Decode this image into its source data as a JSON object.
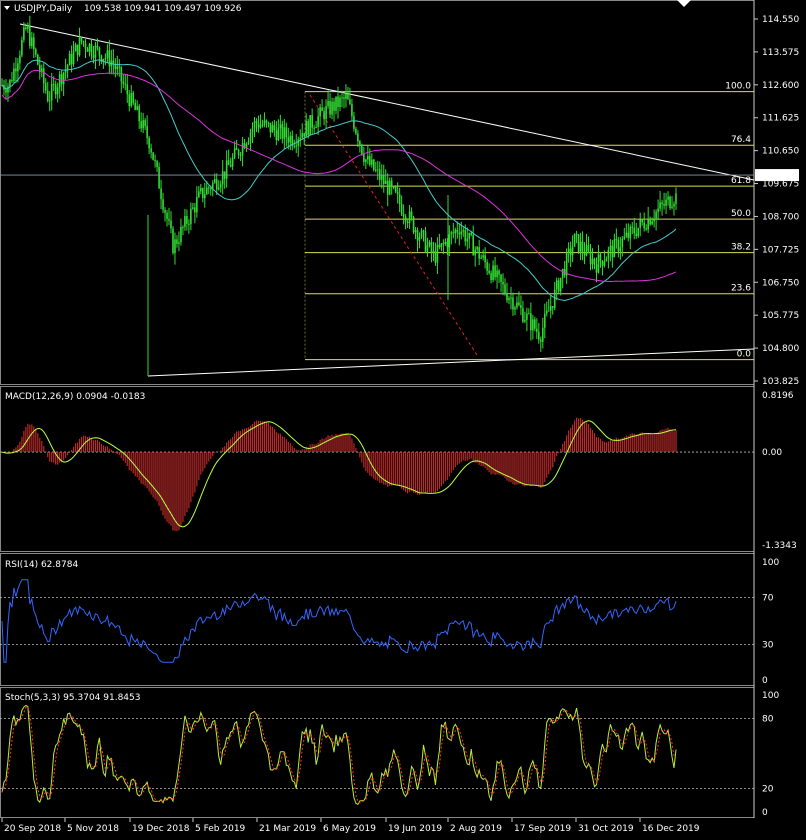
{
  "header": {
    "title": "USDJPY,Daily",
    "ohlc": "109.538 109.941 109.497 109.926"
  },
  "panels": {
    "price": {
      "y_ticks": [
        "114.550",
        "113.575",
        "112.600",
        "111.625",
        "110.650",
        "109.675",
        "108.700",
        "107.725",
        "106.750",
        "105.775",
        "104.800",
        "103.825"
      ],
      "current_price": "109.926",
      "fib_labels": [
        "100.0",
        "76.4",
        "61.8",
        "50.0",
        "38.2",
        "23.6",
        "0.0"
      ]
    },
    "macd": {
      "label": "MACD(12,26,9) 0.0904 -0.0183",
      "y_ticks": [
        "0.8196",
        "0.00",
        "-1.3343"
      ]
    },
    "rsi": {
      "label": "RSI(14) 62.8784",
      "y_ticks": [
        "100",
        "70",
        "30",
        "0"
      ]
    },
    "stoch": {
      "label": "Stoch(5,3,3) 95.3704 91.8453",
      "y_ticks": [
        "100",
        "80",
        "20",
        "0"
      ]
    }
  },
  "x_axis": {
    "labels": [
      "20 Sep 2018",
      "5 Nov 2018",
      "19 Dec 2018",
      "5 Feb 2019",
      "21 Mar 2019",
      "6 May 2019",
      "19 Jun 2019",
      "2 Aug 2019",
      "17 Sep 2019",
      "31 Oct 2019",
      "16 Dec 2019"
    ]
  },
  "chart_data": {
    "type": "line",
    "price_range": [
      103.825,
      115.0
    ],
    "close_keypoints": [
      {
        "x": "20 Sep 2018",
        "y": 112.6
      },
      {
        "x": "1 Oct 2018",
        "y": 114.3
      },
      {
        "x": "15 Oct 2018",
        "y": 112.2
      },
      {
        "x": "5 Nov 2018",
        "y": 113.9
      },
      {
        "x": "25 Nov 2018",
        "y": 113.3
      },
      {
        "x": "19 Dec 2018",
        "y": 110.9
      },
      {
        "x": "3 Jan 2019",
        "y": 107.8
      },
      {
        "x": "20 Jan 2019",
        "y": 109.3
      },
      {
        "x": "5 Feb 2019",
        "y": 110.0
      },
      {
        "x": "25 Feb 2019",
        "y": 111.5
      },
      {
        "x": "21 Mar 2019",
        "y": 111.0
      },
      {
        "x": "10 Apr 2019",
        "y": 111.8
      },
      {
        "x": "24 Apr 2019",
        "y": 112.2
      },
      {
        "x": "6 May 2019",
        "y": 110.4
      },
      {
        "x": "25 May 2019",
        "y": 109.3
      },
      {
        "x": "19 Jun 2019",
        "y": 107.5
      },
      {
        "x": "5 Jul 2019",
        "y": 108.4
      },
      {
        "x": "2 Aug 2019",
        "y": 106.6
      },
      {
        "x": "26 Aug 2019",
        "y": 105.2
      },
      {
        "x": "17 Sep 2019",
        "y": 108.0
      },
      {
        "x": "1 Oct 2019",
        "y": 107.3
      },
      {
        "x": "31 Oct 2019",
        "y": 108.5
      },
      {
        "x": "20 Nov 2019",
        "y": 109.3
      },
      {
        "x": "16 Dec 2019",
        "y": 109.2
      },
      {
        "x": "23 Dec 2019",
        "y": 108.2
      },
      {
        "x": "8 Jan 2020",
        "y": 109.926
      }
    ],
    "fib_levels": [
      {
        "label": "100.0",
        "value": 112.4
      },
      {
        "label": "76.4",
        "value": 110.81
      },
      {
        "label": "61.8",
        "value": 109.6
      },
      {
        "label": "50.0",
        "value": 108.62
      },
      {
        "label": "38.2",
        "value": 107.63
      },
      {
        "label": "23.6",
        "value": 106.41
      },
      {
        "label": "0.0",
        "value": 104.46
      }
    ],
    "macd_range": [
      -1.3343,
      0.8196
    ],
    "colors": {
      "candles": "#33dd33",
      "ma_fast": "#44cccc",
      "ma_slow": "#dd33dd",
      "fib": "#dddd55",
      "macd_hist": "#bb2a2a",
      "macd_signal": "#bbff44",
      "rsi": "#3366ff",
      "stoch_main": "#bbee33",
      "stoch_signal": "#ff3333",
      "grid": "#bbbbbb"
    }
  }
}
